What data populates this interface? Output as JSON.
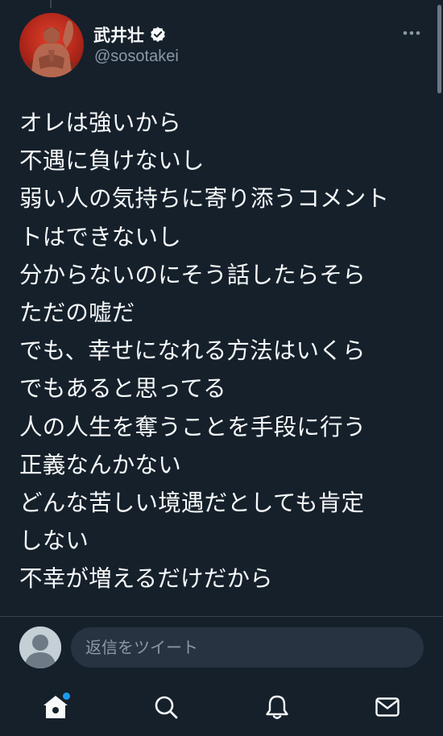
{
  "user": {
    "display_name": "武井壮",
    "handle": "@sosotakei",
    "verified": true,
    "avatar_icon": "profile-photo"
  },
  "tweet": {
    "lines": [
      "オレは強いから",
      "不遇に負けないし",
      "弱い人の気持ちに寄り添うコメント",
      "トはできないし",
      "分からないのにそう話したらそら",
      "ただの嘘だ",
      "でも、幸せになれる方法はいくら",
      "でもあると思ってる",
      "人の人生を奪うことを手段に行う",
      "正義なんかない",
      "どんな苦しい境遇だとしても肯定",
      "しない",
      "不幸が増えるだけだから"
    ]
  },
  "reply": {
    "placeholder": "返信をツイート"
  },
  "nav": {
    "items": [
      {
        "icon": "home-icon",
        "active": true,
        "has_notification_dot": true
      },
      {
        "icon": "search-icon",
        "active": false
      },
      {
        "icon": "bell-icon",
        "active": false
      },
      {
        "icon": "mail-icon",
        "active": false
      }
    ]
  },
  "colors": {
    "background": "#15202b",
    "text": "#f7f9f9",
    "secondary_text": "#8b98a5",
    "accent": "#1d9bf0",
    "input_background": "#273340",
    "divider": "#38444d"
  }
}
